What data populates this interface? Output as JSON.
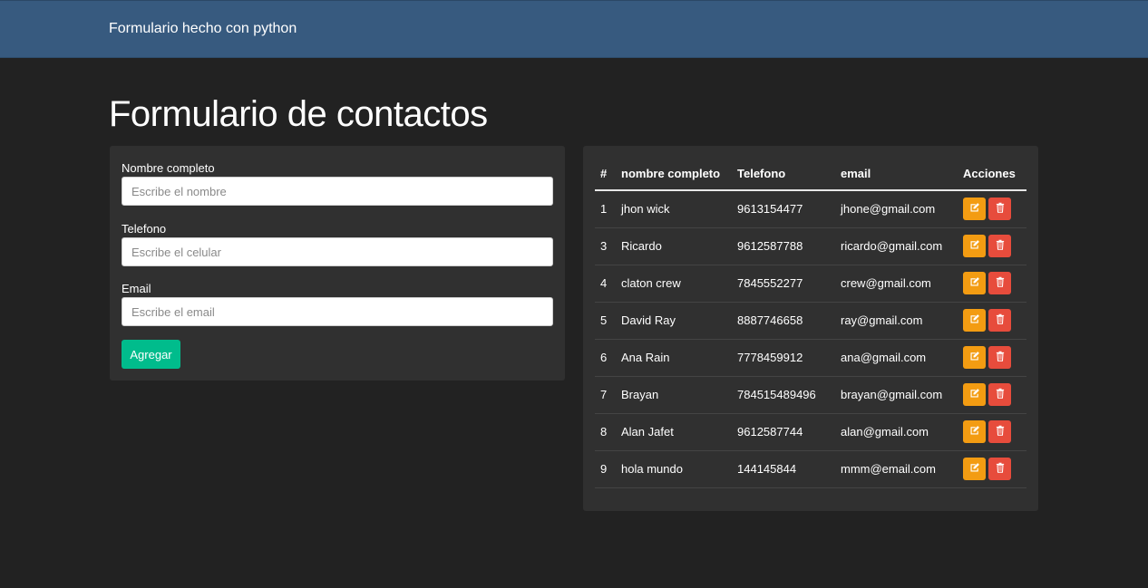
{
  "navbar": {
    "brand": "Formulario hecho con python"
  },
  "page": {
    "title": "Formulario de contactos"
  },
  "form": {
    "name_label": "Nombre completo",
    "name_placeholder": "Escribe el nombre",
    "phone_label": "Telefono",
    "phone_placeholder": "Escribe el celular",
    "email_label": "Email",
    "email_placeholder": "Escribe el email",
    "submit_label": "Agregar"
  },
  "table": {
    "headers": [
      "#",
      "nombre completo",
      "Telefono",
      "email",
      "Acciones"
    ],
    "rows": [
      {
        "id": "1",
        "name": "jhon wick",
        "phone": "9613154477",
        "email": "jhone@gmail.com"
      },
      {
        "id": "3",
        "name": "Ricardo",
        "phone": "9612587788",
        "email": "ricardo@gmail.com"
      },
      {
        "id": "4",
        "name": "claton crew",
        "phone": "7845552277",
        "email": "crew@gmail.com"
      },
      {
        "id": "5",
        "name": "David Ray",
        "phone": "8887746658",
        "email": "ray@gmail.com"
      },
      {
        "id": "6",
        "name": "Ana Rain",
        "phone": "7778459912",
        "email": "ana@gmail.com"
      },
      {
        "id": "7",
        "name": "Brayan",
        "phone": "784515489496",
        "email": "brayan@gmail.com"
      },
      {
        "id": "8",
        "name": "Alan Jafet",
        "phone": "9612587744",
        "email": "alan@gmail.com"
      },
      {
        "id": "9",
        "name": "hola mundo",
        "phone": "144145844",
        "email": "mmm@email.com"
      }
    ],
    "action_icons": {
      "edit": "edit-icon",
      "delete": "trash-icon"
    }
  },
  "colors": {
    "navbar": "#375a7f",
    "background": "#222222",
    "card": "#303030",
    "primary_button": "#00bc8c",
    "edit_button": "#f39c12",
    "delete_button": "#e74c3c"
  }
}
